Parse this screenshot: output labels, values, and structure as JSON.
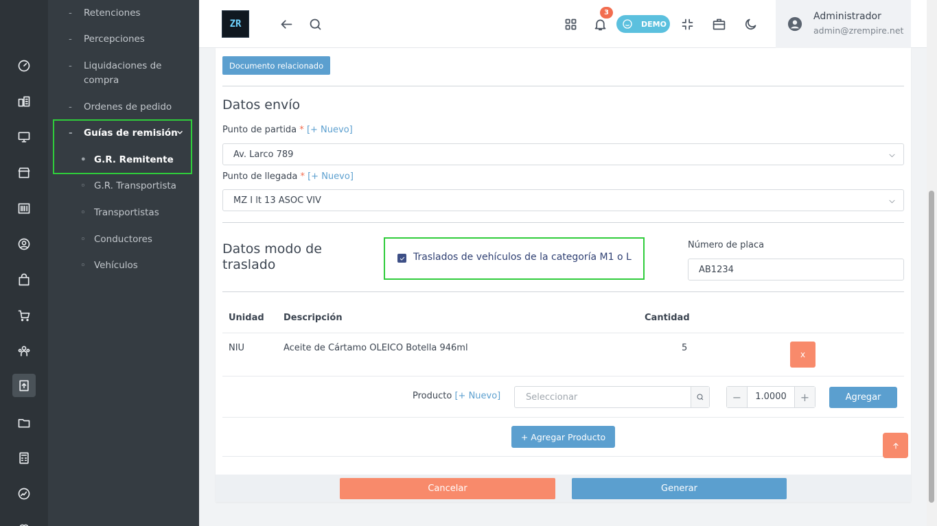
{
  "sidebar": {
    "items": [
      {
        "label": "Retenciones",
        "bullet": "-"
      },
      {
        "label": "Percepciones",
        "bullet": "-"
      },
      {
        "label": "Liquidaciones de compra",
        "bullet": "-"
      },
      {
        "label": "Ordenes de pedido",
        "bullet": "-"
      },
      {
        "label": "Guías de remisión",
        "bullet": "-"
      },
      {
        "label": "G.R. Remitente",
        "bullet": "•"
      },
      {
        "label": "G.R. Transportista",
        "bullet": "◦"
      },
      {
        "label": "Transportistas",
        "bullet": "◦"
      },
      {
        "label": "Conductores",
        "bullet": "◦"
      },
      {
        "label": "Vehículos",
        "bullet": "◦"
      }
    ]
  },
  "rail": {
    "icons": [
      "dashboard-icon",
      "building-icon",
      "monitor-icon",
      "store-icon",
      "barcode-icon",
      "user-circle-icon",
      "bag-icon",
      "cart-icon",
      "users-icon",
      "dispatch-icon",
      "folder-icon",
      "calculator-icon",
      "chart-icon",
      "heart-icon"
    ]
  },
  "header": {
    "logo_text": "ZR",
    "notification_count": "3",
    "demo_label": "DEMO",
    "user_name": "Administrador",
    "user_email": "admin@zrempire.net"
  },
  "form": {
    "doc_button": "Documento relacionado",
    "shipping": {
      "title": "Datos envío",
      "origin_label": "Punto de partida",
      "origin_new": "[+ Nuevo]",
      "origin_value": "Av. Larco 789",
      "dest_label": "Punto de llegada",
      "dest_new": "[+ Nuevo]",
      "dest_value": "MZ I lt 13 ASOC VIV",
      "required_mark": "*"
    },
    "transport": {
      "title": "Datos modo de traslado",
      "checkbox_label": "Traslados de vehículos de la categoría M1 o L",
      "checkbox_checked": true,
      "plate_label": "Número de placa",
      "plate_value": "AB1234"
    },
    "items_table": {
      "headers": [
        "Unidad",
        "Descripción",
        "Cantidad"
      ],
      "rows": [
        {
          "unit": "NIU",
          "description": "Aceite de Cártamo OLEICO Botella 946ml",
          "quantity": "5",
          "remove": "x"
        }
      ]
    },
    "add_product": {
      "label": "Producto",
      "new_link": "[+ Nuevo]",
      "placeholder": "Seleccionar",
      "qty_value": "1.0000",
      "minus": "−",
      "plus": "+",
      "add_button": "Agregar",
      "add_product_button": "+ Agregar Producto"
    },
    "footer": {
      "cancel": "Cancelar",
      "generate": "Generar"
    }
  },
  "colors": {
    "primary": "#5b9fcf",
    "danger": "#f88a6b",
    "highlight": "#2fcc3b",
    "sidebar": "#353c42",
    "rail": "#2d3338"
  }
}
